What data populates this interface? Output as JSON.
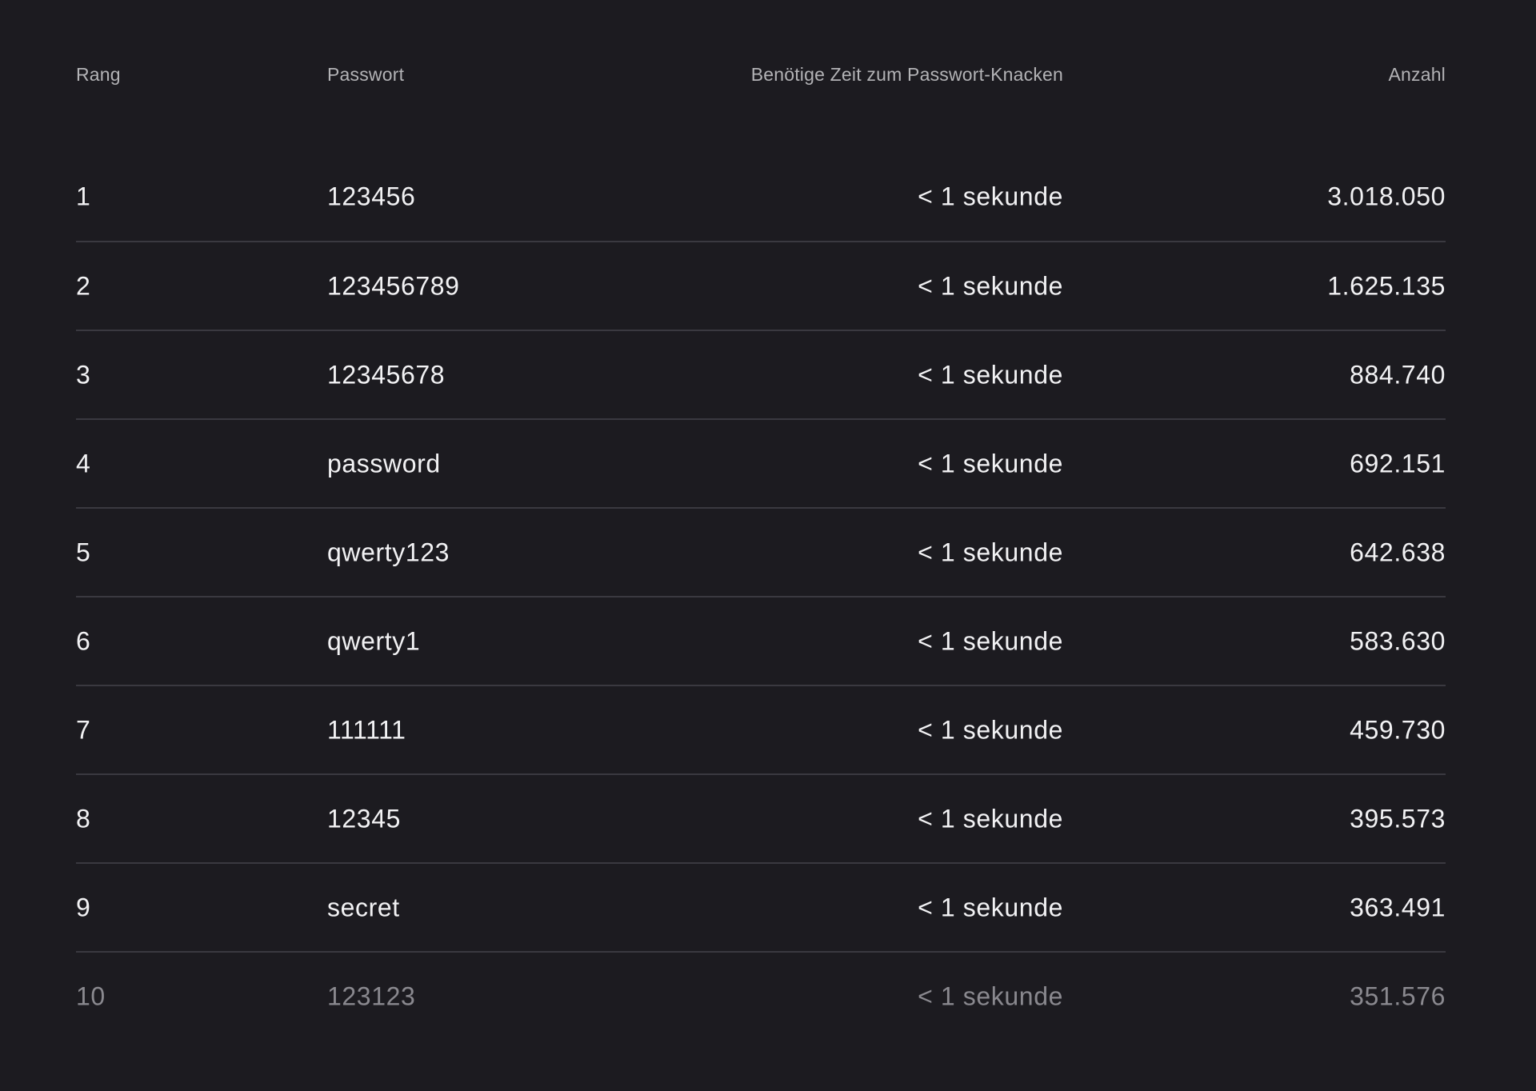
{
  "table": {
    "headers": {
      "rank": "Rang",
      "password": "Passwort",
      "crack_time": "Benötige Zeit zum Passwort-Knacken",
      "count": "Anzahl"
    },
    "rows": [
      {
        "rank": "1",
        "password": "123456",
        "crack_time": "< 1 sekunde",
        "count": "3.018.050"
      },
      {
        "rank": "2",
        "password": "123456789",
        "crack_time": "< 1 sekunde",
        "count": "1.625.135"
      },
      {
        "rank": "3",
        "password": "12345678",
        "crack_time": "< 1 sekunde",
        "count": "884.740"
      },
      {
        "rank": "4",
        "password": "password",
        "crack_time": "< 1 sekunde",
        "count": "692.151"
      },
      {
        "rank": "5",
        "password": "qwerty123",
        "crack_time": "< 1 sekunde",
        "count": "642.638"
      },
      {
        "rank": "6",
        "password": "qwerty1",
        "crack_time": "< 1 sekunde",
        "count": "583.630"
      },
      {
        "rank": "7",
        "password": "111111",
        "crack_time": "< 1 sekunde",
        "count": "459.730"
      },
      {
        "rank": "8",
        "password": "12345",
        "crack_time": "< 1 sekunde",
        "count": "395.573"
      },
      {
        "rank": "9",
        "password": "secret",
        "crack_time": "< 1 sekunde",
        "count": "363.491"
      },
      {
        "rank": "10",
        "password": "123123",
        "crack_time": "< 1 sekunde",
        "count": "351.576"
      }
    ]
  }
}
